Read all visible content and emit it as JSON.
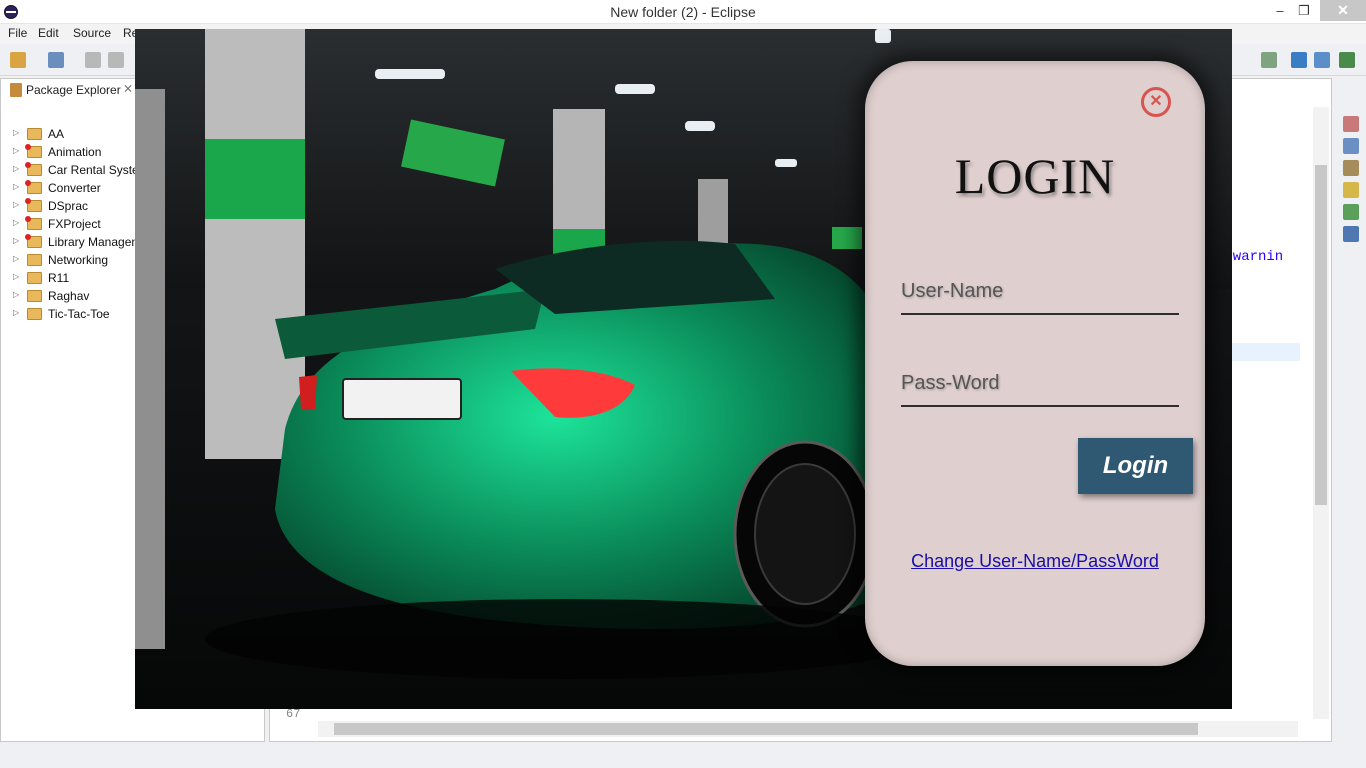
{
  "window": {
    "title": "New folder (2) - Eclipse"
  },
  "menu": [
    "File",
    "Edit",
    "Source",
    "Re"
  ],
  "package_explorer": {
    "title": "Package Explorer",
    "items": [
      {
        "name": "AA",
        "error": false
      },
      {
        "name": "Animation",
        "error": true
      },
      {
        "name": "Car Rental Syster",
        "error": true
      },
      {
        "name": "Converter",
        "error": true
      },
      {
        "name": "DSprac",
        "error": true
      },
      {
        "name": "FXProject",
        "error": true
      },
      {
        "name": "Library Managen",
        "error": true
      },
      {
        "name": "Networking",
        "error": false
      },
      {
        "name": "R11",
        "error": false
      },
      {
        "name": "Raghav",
        "error": false
      },
      {
        "name": "Tic-Tac-Toe",
        "error": false
      }
    ]
  },
  "editor": {
    "line_number": "67",
    "code_fragment": "e:warnin"
  },
  "login": {
    "title": "LOGIN",
    "close_icon": "close-icon",
    "username_placeholder": "User-Name",
    "password_placeholder": "Pass-Word",
    "button_label": "Login",
    "change_link": "Change User-Name/PassWord"
  },
  "colors": {
    "card_bg": "#dfcfcf",
    "button_bg": "#2f5872",
    "close_red": "#d9534f",
    "link": "#1a0dab",
    "car_green": "#0fae6a"
  }
}
